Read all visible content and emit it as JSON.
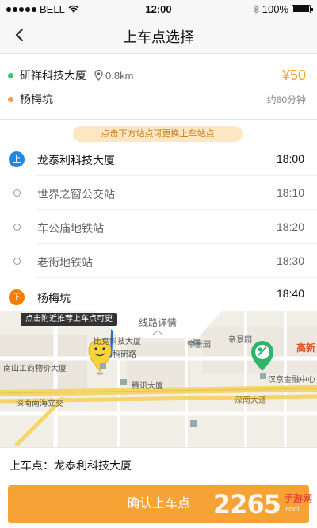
{
  "status_bar": {
    "carrier": "BELL",
    "time": "12:00",
    "battery": "100%"
  },
  "nav": {
    "title": "上车点选择"
  },
  "trip": {
    "origin": "研祥科技大厦",
    "distance": "0.8km",
    "destination": "杨梅坑",
    "price": "¥50",
    "eta": "约60分钟"
  },
  "hint": "点击下方站点可更换上车站点",
  "stops": [
    {
      "badge": "上",
      "name": "龙泰利科技大厦",
      "time": "18:00"
    },
    {
      "badge": "",
      "name": "世界之窗公交站",
      "time": "18:10"
    },
    {
      "badge": "",
      "name": "车公庙地铁站",
      "time": "18:20"
    },
    {
      "badge": "",
      "name": "老街地铁站",
      "time": "18:30"
    },
    {
      "badge": "下",
      "name": "杨梅坑",
      "time": "18:40"
    }
  ],
  "colors": {
    "accent": "#f7a234",
    "board": "#1e88e5",
    "alight": "#f57c00",
    "origin_dot": "#3cc46b",
    "dest_dot": "#f39c4a"
  },
  "map": {
    "tooltip": "点击附近推荐上车点可更",
    "detail_tab": "线路详情",
    "labels": {
      "bike": "比克科技大厦",
      "keyan": "科研路",
      "tencent": "腾讯大厦",
      "dijing": "帝景园",
      "dijingyuan": "帝景园",
      "gaoxin": "高新",
      "hanjing": "汉京金融中心",
      "nanshan": "南山工商物价大厦",
      "shennan_cross": "深南南海立交",
      "shennan_ave": "深南大道"
    }
  },
  "pickup": {
    "label": "上车点：",
    "value": "龙泰利科技大厦"
  },
  "confirm_button": "确认上车点",
  "watermark": {
    "number": "2265",
    "site": "手游网",
    "domain": ".com"
  }
}
